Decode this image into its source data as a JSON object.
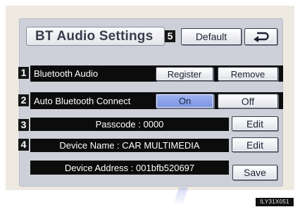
{
  "title": "BT Audio Settings",
  "badges": [
    "1",
    "2",
    "3",
    "4",
    "5"
  ],
  "header": {
    "default_label": "Default"
  },
  "rows": {
    "bluetooth_audio": {
      "label": "Bluetooth Audio",
      "register_label": "Register",
      "remove_label": "Remove"
    },
    "auto_connect": {
      "label": "Auto Bluetooth Connect",
      "on_label": "On",
      "off_label": "Off",
      "selected": "On"
    },
    "passcode": {
      "text": "Passcode : 0000",
      "edit_label": "Edit"
    },
    "device_name": {
      "text": "Device Name : CAR MULTIMEDIA",
      "edit_label": "Edit"
    },
    "device_address": {
      "text": "Device Address : 001bfb520697",
      "save_label": "Save"
    }
  },
  "watermark": "ILY31X051",
  "colors": {
    "selected_button": "#7f98e5",
    "screen_bg": "#cdd0d8",
    "bar_bg": "#0c0c0c"
  }
}
